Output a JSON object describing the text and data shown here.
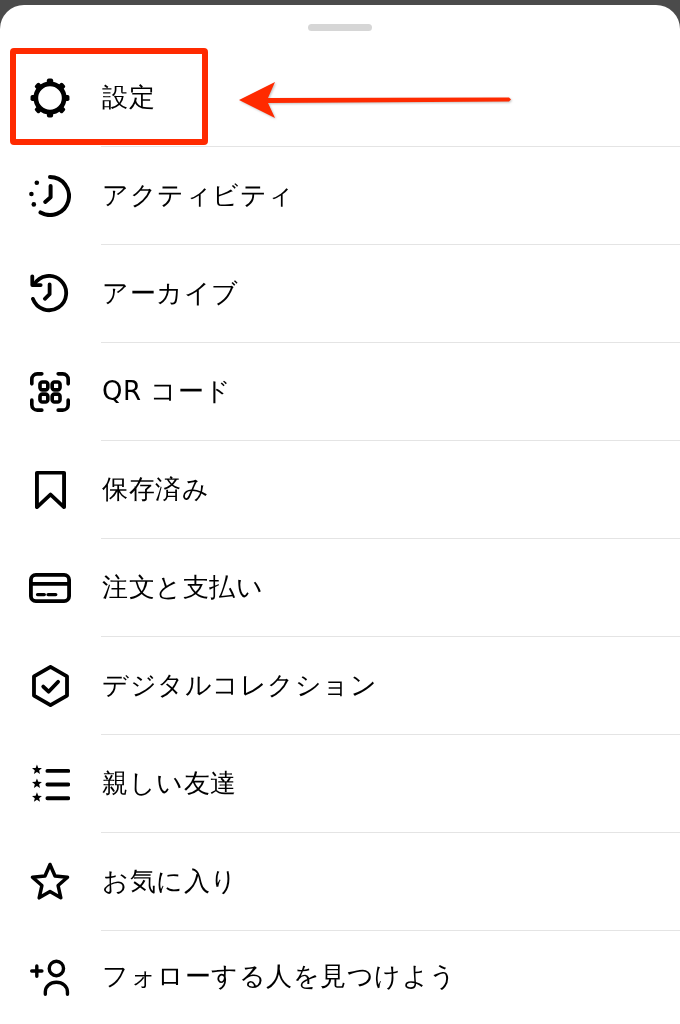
{
  "menu": {
    "items": [
      {
        "kind": "settings",
        "label": "設定",
        "highlighted": true
      },
      {
        "kind": "activity",
        "label": "アクティビティ",
        "highlighted": false
      },
      {
        "kind": "archive",
        "label": "アーカイブ",
        "highlighted": false
      },
      {
        "kind": "qrcode",
        "label": "QR コード",
        "highlighted": false
      },
      {
        "kind": "saved",
        "label": "保存済み",
        "highlighted": false
      },
      {
        "kind": "payments",
        "label": "注文と支払い",
        "highlighted": false
      },
      {
        "kind": "collectibles",
        "label": "デジタルコレクション",
        "highlighted": false
      },
      {
        "kind": "closefriends",
        "label": "親しい友達",
        "highlighted": false
      },
      {
        "kind": "favorites",
        "label": "お気に入り",
        "highlighted": false
      },
      {
        "kind": "discover",
        "label": "フォローする人を見つけよう",
        "highlighted": false
      }
    ]
  }
}
